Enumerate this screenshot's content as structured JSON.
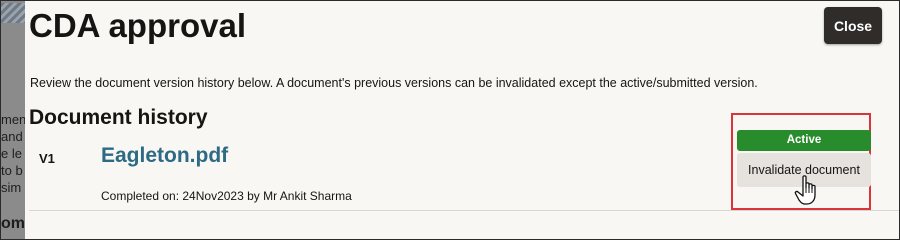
{
  "background_page": {
    "lines": [
      "ment",
      "and",
      "e le",
      "to b",
      "sim"
    ],
    "bottom_text": "omp"
  },
  "dialog": {
    "title": "CDA approval",
    "close_label": "Close",
    "description": "Review the document version history below. A document's previous versions can be invalidated except the active/submitted version.",
    "section_title": "Document history"
  },
  "history": {
    "version": "V1",
    "file_name": "Eagleton.pdf",
    "completed": "Completed on: 24Nov2023 by Mr Ankit Sharma",
    "status_badge": "Active",
    "invalidate_label": "Invalidate document"
  },
  "colors": {
    "accent_link": "#2d6a84",
    "active_badge": "#288b2c",
    "highlight_border": "#d9343c",
    "close_button": "#2f2c29"
  },
  "icons": {
    "cursor": "hand-pointer-icon"
  }
}
